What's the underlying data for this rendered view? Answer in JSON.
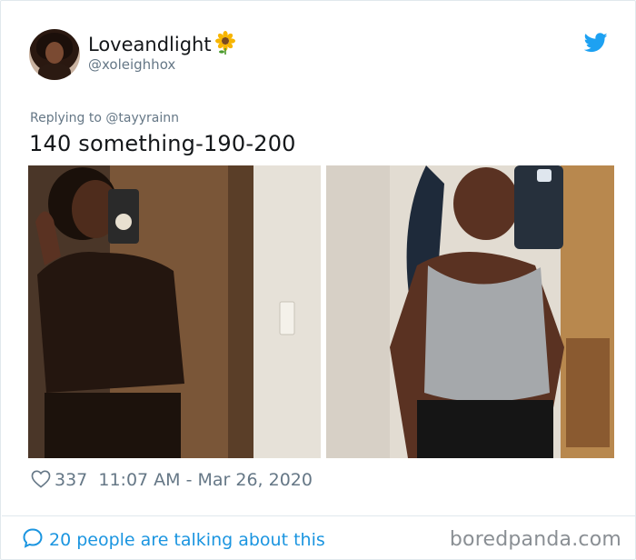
{
  "tweet": {
    "author": {
      "display_name": "Loveandlight",
      "emoji": "sunflower-icon",
      "handle": "@xoleighhox"
    },
    "reply_to": "Replying to @tayyrainn",
    "text": "140 something-190-200",
    "likes": "337",
    "timestamp": "11:07 AM - Mar 26, 2020",
    "talking": "20 people are talking about this"
  },
  "watermark": "boredpanda.com",
  "colors": {
    "twitter_blue": "#1da1f2",
    "link_blue": "#1b95e0",
    "secondary_text": "#657786",
    "primary_text": "#14171a"
  }
}
